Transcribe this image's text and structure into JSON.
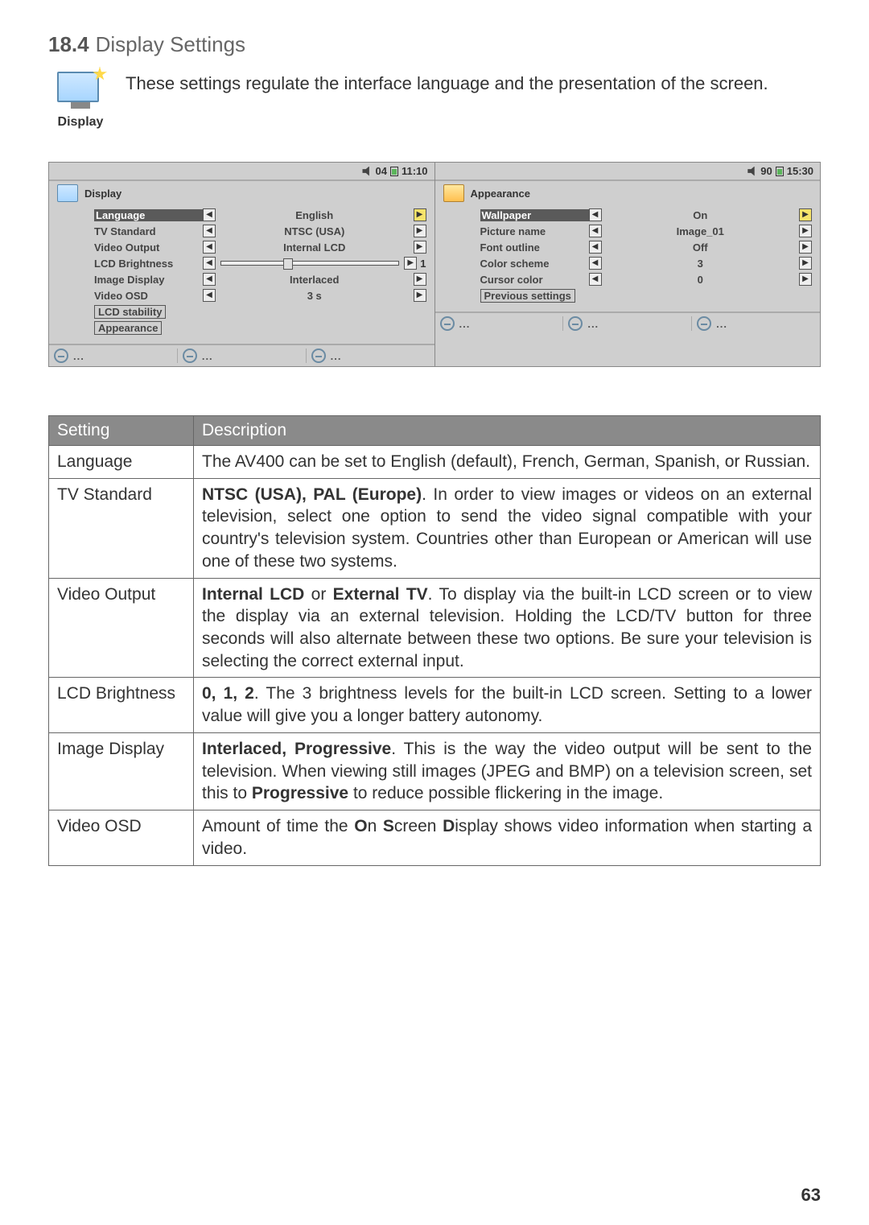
{
  "heading": {
    "number": "18.4",
    "title": "Display Settings"
  },
  "display_icon_caption": "Display",
  "intro": "These settings regulate the interface language and the presentation of the screen.",
  "shot_left": {
    "status": {
      "battery": "04",
      "time": "11:10"
    },
    "title": "Display",
    "rows": [
      {
        "label": "Language",
        "value": "English",
        "selected": true
      },
      {
        "label": "TV Standard",
        "value": "NTSC (USA)"
      },
      {
        "label": "Video Output",
        "value": "Internal LCD"
      },
      {
        "label": "LCD Brightness",
        "value": "1",
        "slider": true
      },
      {
        "label": "Image Display",
        "value": "Interlaced"
      },
      {
        "label": "Video OSD",
        "value": "3 s"
      }
    ],
    "extra": [
      "LCD stability",
      "Appearance"
    ]
  },
  "shot_right": {
    "status": {
      "battery": "90",
      "time": "15:30"
    },
    "title": "Appearance",
    "rows": [
      {
        "label": "Wallpaper",
        "value": "On",
        "selected": true
      },
      {
        "label": "Picture name",
        "value": "Image_01"
      },
      {
        "label": "Font outline",
        "value": "Off"
      },
      {
        "label": "Color scheme",
        "value": "3"
      },
      {
        "label": "Cursor color",
        "value": "0"
      }
    ],
    "extra": [
      "Previous settings"
    ]
  },
  "table": {
    "headers": [
      "Setting",
      "Description"
    ],
    "rows": [
      {
        "setting": "Language",
        "desc_html": "The AV400 can be set to English (default), French, German, Spanish, or Russian."
      },
      {
        "setting": "TV Standard",
        "desc_html": "<b>NTSC (USA), PAL (Europe)</b>. In order to view images or videos on an external television, select one option to send the video signal compatible with your country's television system. Countries other than European or American will use one of these two systems."
      },
      {
        "setting": "Video Output",
        "desc_html": "<b>Internal LCD</b> or <b>External TV</b>. To display via the built-in LCD screen or to view the display via an external television. Holding the LCD/TV button for three seconds will also alternate between these two options. Be sure your television is selecting the correct external input."
      },
      {
        "setting": "LCD Brightness",
        "desc_html": "<b>0, 1, 2</b>. The 3 brightness levels for the built-in LCD screen. Setting to a lower value will give you a longer battery autonomy."
      },
      {
        "setting": "Image Display",
        "desc_html": "<b>Interlaced, Progressive</b>. This is the way the video output will be sent to the television. When viewing still images (JPEG and BMP) on a television screen, set this to <b>Progressive</b> to reduce possible flickering in the image."
      },
      {
        "setting": "Video OSD",
        "desc_html": "Amount of time the <b>O</b>n <b>S</b>creen <b>D</b>isplay shows video information when starting a video."
      }
    ]
  },
  "page_number": "63"
}
